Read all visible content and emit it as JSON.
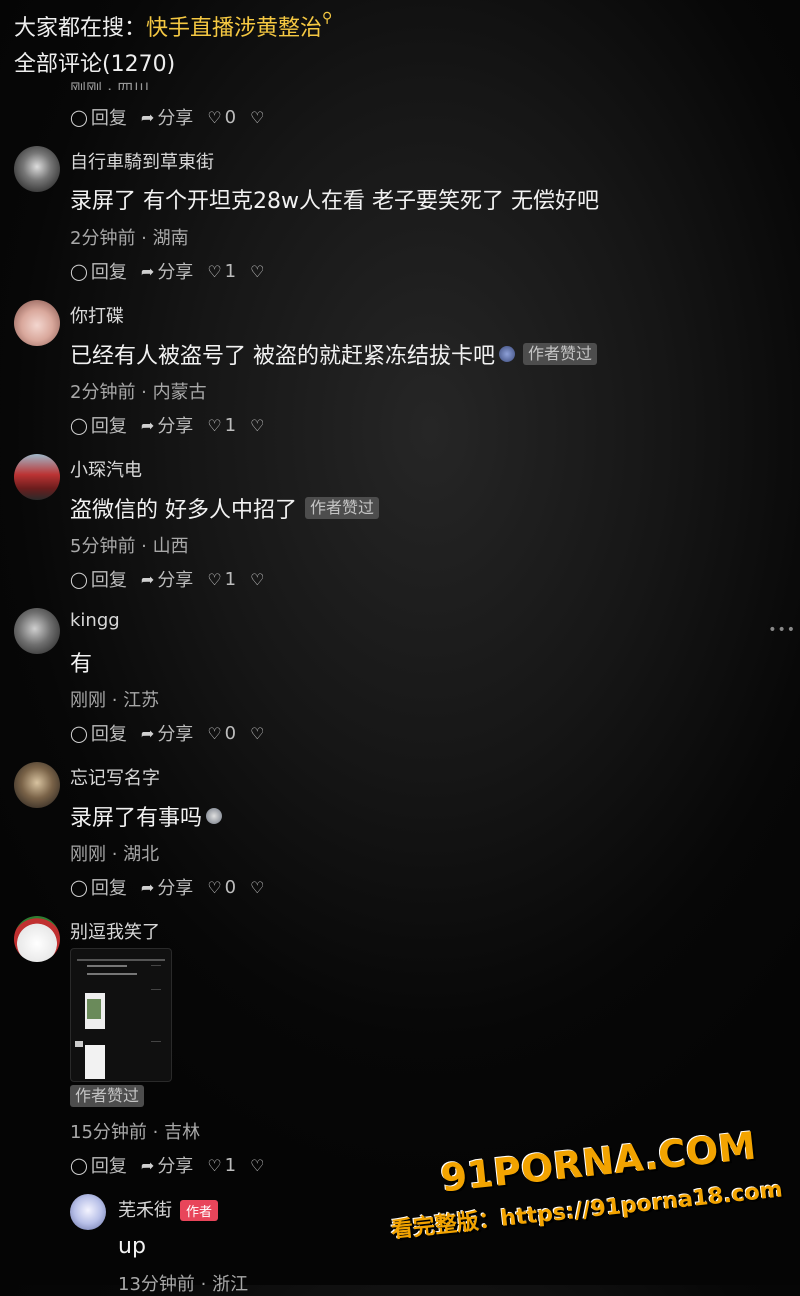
{
  "search": {
    "prefix": "大家都在搜：",
    "hot_term": "快手直播涉黄整治"
  },
  "comments_header": "全部评论(1270)",
  "clipped_previous": {
    "meta": "刚刚 · 四川",
    "reply": "回复",
    "share": "分享",
    "likes": "0"
  },
  "comments": [
    {
      "user": "自行車騎到草東街",
      "text": "录屏了 有个开坦克28w人在看 老子要笑死了 无偿好吧",
      "meta": "2分钟前 · 湖南",
      "reply": "回复",
      "share": "分享",
      "likes": "1"
    },
    {
      "user": "你打碟",
      "text": "已经有人被盗号了 被盗的就赶紧冻结拔卡吧",
      "liked_badge": "作者赞过",
      "meta": "2分钟前 · 内蒙古",
      "reply": "回复",
      "share": "分享",
      "likes": "1"
    },
    {
      "user": "小琛汽电",
      "text": "盗微信的 好多人中招了",
      "liked_badge": "作者赞过",
      "meta": "5分钟前 · 山西",
      "reply": "回复",
      "share": "分享",
      "likes": "1"
    },
    {
      "user": "kingg",
      "text": "有",
      "meta": "刚刚 · 江苏",
      "reply": "回复",
      "share": "分享",
      "likes": "0"
    },
    {
      "user": "忘记写名字",
      "text": "录屏了有事吗",
      "meta": "刚刚 · 湖北",
      "reply": "回复",
      "share": "分享",
      "likes": "0"
    },
    {
      "user": "别逗我笑了",
      "liked_badge": "作者赞过",
      "meta": "15分钟前 · 吉林",
      "reply": "回复",
      "share": "分享",
      "likes": "1"
    }
  ],
  "reply": {
    "user": "芜禾街",
    "author_badge": "作者",
    "text": "up",
    "meta": "13分钟前 · 浙江"
  },
  "watermark": {
    "logo": "91PORNA.COM",
    "url": "看完整版：https://91porna18.com"
  },
  "colors": {
    "hot_search": "#f5c842",
    "badge_bg": "#4d4d4d",
    "author_badge": "#e8455a",
    "watermark": "#f2a300"
  }
}
